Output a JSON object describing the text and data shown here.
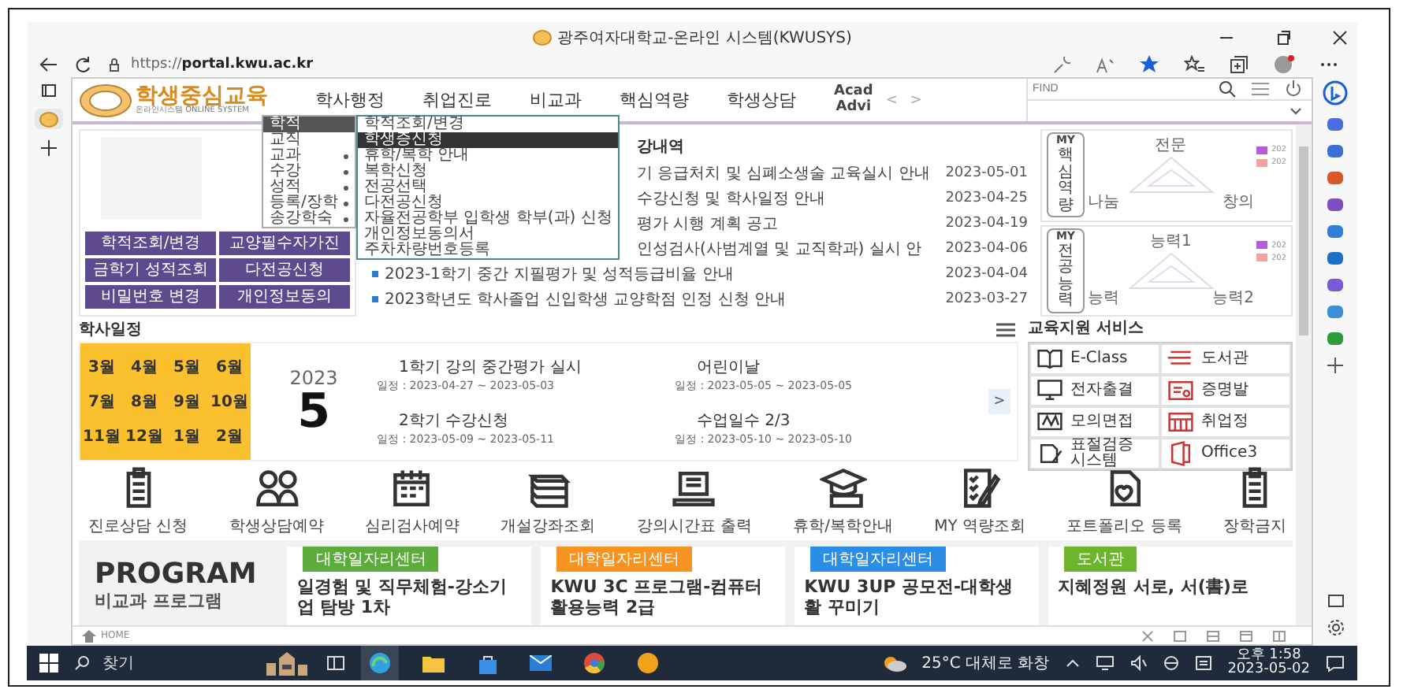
{
  "browser": {
    "title": "광주여자대학교-온라인 시스템(KWUSYS)",
    "url": "https://**portal.kwu.ac.kr**"
  },
  "header": {
    "logo_title": "학생중심교육",
    "logo_subtitle": "온라인시스템 ONLINE SYSTEM",
    "nav": [
      "학사행정",
      "취업진로",
      "비교과",
      "핵심역량",
      "학생상담"
    ],
    "nav_more": [
      "Acad",
      "Advi"
    ],
    "nav_arrows": [
      "<",
      ">"
    ],
    "find": {
      "placeholder": "FIND"
    }
  },
  "menu": {
    "items": [
      {
        "label": "학적",
        "selected": true,
        "has_submenu": false
      },
      {
        "label": "교직",
        "selected": false,
        "has_submenu": false
      },
      {
        "label": "교과",
        "selected": false,
        "has_submenu": true
      },
      {
        "label": "수강",
        "selected": false,
        "has_submenu": true
      },
      {
        "label": "성적",
        "selected": false,
        "has_submenu": true
      },
      {
        "label": "등록/장학",
        "selected": false,
        "has_submenu": true
      },
      {
        "label": "송강학숙",
        "selected": false,
        "has_submenu": true
      }
    ],
    "submenu": [
      {
        "label": "학적조회/변경",
        "selected": false
      },
      {
        "label": "학생증신청",
        "selected": true
      },
      {
        "label": "휴학/복학 안내",
        "selected": false
      },
      {
        "label": "복학신청",
        "selected": false
      },
      {
        "label": "전공선택",
        "selected": false
      },
      {
        "label": "다전공신청",
        "selected": false
      },
      {
        "label": "자율전공학부 입학생 학부(과) 신청",
        "selected": false
      },
      {
        "label": "개인정보동의서",
        "selected": false
      },
      {
        "label": "주차차량번호등록",
        "selected": false
      }
    ]
  },
  "profile": {
    "buttons": [
      "학적조회/변경",
      "교양필수자가진",
      "금학기 성적조회",
      "다전공신청",
      "비밀번호 변경",
      "개인정보동의"
    ]
  },
  "notices": {
    "title": "강내역",
    "rows": [
      {
        "kind": "partial",
        "text": "기 응급처치 및 심폐소생술 교육실시 안내",
        "date": "2023-05-01"
      },
      {
        "kind": "partial",
        "text": "수강신청 및 학사일정 안내",
        "date": "2023-04-25"
      },
      {
        "kind": "partial",
        "text": "평가 시행 계획 공고",
        "date": "2023-04-19"
      },
      {
        "kind": "partial",
        "text": "인성검사(사범계열 및 교직학과) 실시 안",
        "date": "2023-04-06"
      },
      {
        "kind": "full",
        "text": "2023-1학기 중간 지필평가 및 성적등급비율 안내",
        "date": "2023-04-04"
      },
      {
        "kind": "full",
        "text": "2023학년도 학사졸업 신입학생 교양학점 인정 신청 안내",
        "date": "2023-03-27"
      }
    ]
  },
  "competency": [
    {
      "label": "MY",
      "title": "핵심역량",
      "axes": [
        "전문",
        "나눔",
        "창의"
      ],
      "legend": [
        {
          "text": "202",
          "color": "#b45cd9"
        },
        {
          "text": "202",
          "color": "#f0a3a3"
        }
      ]
    },
    {
      "label": "MY",
      "title": "전공능력",
      "axes": [
        "능력1",
        "능력",
        "능력2"
      ],
      "legend": [
        {
          "text": "202",
          "color": "#b45cd9"
        },
        {
          "text": "202",
          "color": "#f0a3a3"
        }
      ]
    }
  ],
  "schedule": {
    "title": "학사일정",
    "months": [
      "3월",
      "4월",
      "5월",
      "6월",
      "7월",
      "8월",
      "9월",
      "10월",
      "11월",
      "12월",
      "1월",
      "2월"
    ],
    "year": "2023",
    "month": "5",
    "events": [
      {
        "title": "1학기 강의 중간평가 실시",
        "period": "일정 : 2023-04-27 ~ 2023-05-03"
      },
      {
        "title": "어린이날",
        "period": "일정 : 2023-05-05 ~ 2023-05-05"
      },
      {
        "title": "2학기 수강신청",
        "period": "일정 : 2023-05-09 ~ 2023-05-11"
      },
      {
        "title": "수업일수 2/3",
        "period": "일정 : 2023-05-10 ~ 2023-05-10"
      }
    ],
    "next": ">"
  },
  "services": {
    "title": "교육지원 서비스",
    "items": [
      "E-Class",
      "도서관",
      "전자출결",
      "증명발",
      "모의면접",
      "취업정",
      "표절검증 시스템",
      "Office3"
    ]
  },
  "quick_links": [
    "진로상담 신청",
    "학생상담예약",
    "심리검사예약",
    "개설강좌조회",
    "강의시간표 출력",
    "휴학/복학안내",
    "MY 역량조회",
    "포트폴리오 등록",
    "장학금지"
  ],
  "program": {
    "title": "PROGRAM",
    "subtitle": "비교과 프로그램",
    "cards": [
      {
        "tag": "대학일자리센터",
        "color": "#5dab3c",
        "title": "일경험 및 직무체험-강소기업 탐방 1차"
      },
      {
        "tag": "대학일자리센터",
        "color": "#f7931e",
        "title": "KWU 3C 프로그램-컴퓨터활용능력 2급"
      },
      {
        "tag": "대학일자리센터",
        "color": "#2b8de6",
        "title": "KWU 3UP 공모전-대학생활 꾸미기"
      },
      {
        "tag": "도서관",
        "color": "#6cb52d",
        "title": "지혜정원 서로, 서(書)로"
      }
    ]
  },
  "status_bar": {
    "home": "HOME"
  },
  "taskbar": {
    "search": "찾기",
    "weather": "25°C 대체로 화창",
    "time": "오후 1:58",
    "date": "2023-05-02"
  }
}
